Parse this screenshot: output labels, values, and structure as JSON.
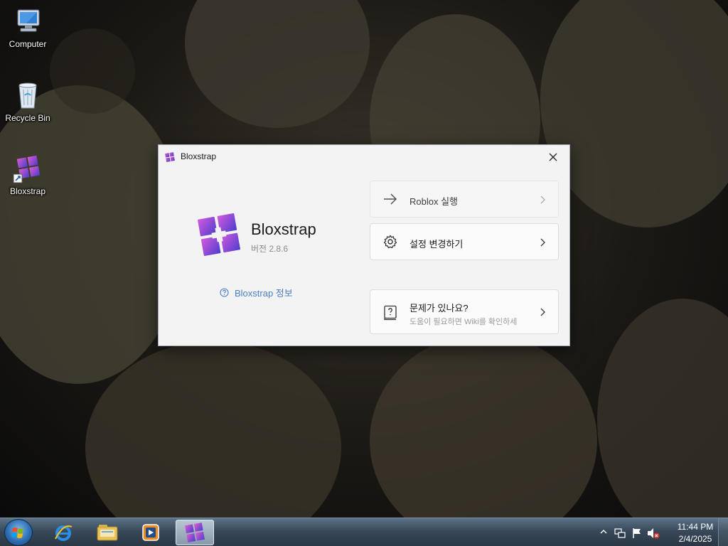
{
  "desktop": {
    "icons": [
      {
        "label": "Computer",
        "icon": "computer-icon"
      },
      {
        "label": "Recycle Bin",
        "icon": "recycle-bin-icon"
      },
      {
        "label": "Bloxstrap",
        "icon": "bloxstrap-shortcut-icon"
      }
    ]
  },
  "window": {
    "title": "Bloxstrap",
    "app_name": "Bloxstrap",
    "version": "버전 2.8.6",
    "about_link": "Bloxstrap 정보",
    "cards": {
      "launch": {
        "label": "Roblox 실행",
        "icon": "arrow-right-icon"
      },
      "settings": {
        "label": "설정 변경하기",
        "icon": "gear-icon"
      },
      "help": {
        "label": "문제가 있나요?",
        "sub": "도움이 필요하면 Wiki를 확인하세",
        "icon": "help-book-icon"
      }
    }
  },
  "taskbar": {
    "pinned": [
      "internet-explorer-icon",
      "file-explorer-icon",
      "media-player-icon",
      "bloxstrap-taskbar-icon"
    ],
    "tray": {
      "icons": [
        "show-hidden-icons-chevron",
        "network-icon",
        "action-center-flag-icon",
        "volume-muted-icon"
      ],
      "time": "11:44 PM",
      "date": "2/4/2025"
    }
  },
  "colors": {
    "brand_gradient_start": "#c44fd9",
    "brand_gradient_end": "#5b3fd0",
    "link": "#4a7fc4",
    "taskbar": "#3a4a5b"
  }
}
